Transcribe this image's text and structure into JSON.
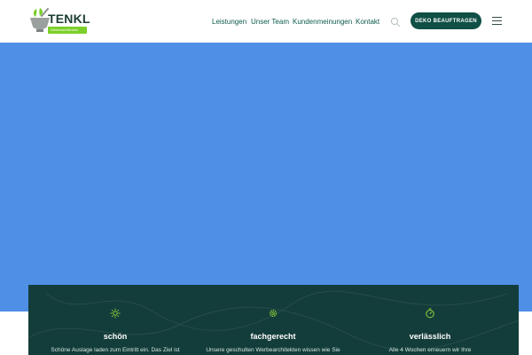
{
  "header": {
    "logo": {
      "word": "TENKL",
      "tagline": "Werbearchitekten"
    },
    "nav": [
      {
        "label": "Leistungen"
      },
      {
        "label": "Unser Team"
      },
      {
        "label": "Kundenmeinungen"
      },
      {
        "label": "Kontakt"
      }
    ],
    "search_icon": "search-icon",
    "cta_label": "DEKO BEAUFTRAGEN",
    "menu_icon": "hamburger-menu-icon"
  },
  "hero": {
    "background_color": "#4f8fe6"
  },
  "features": [
    {
      "icon": "sun-icon",
      "title": "schön",
      "text": "Schöne Auslage laden zum Eintritt ein. Das Ziel ist"
    },
    {
      "icon": "gear-icon",
      "title": "fachgerecht",
      "text": "Unsere geschulten Werbearchitekten wissen wie Sie"
    },
    {
      "icon": "stopwatch-icon",
      "title": "verlässlich",
      "text": "Alle 4 Wochen erneuern wir Ihre"
    }
  ],
  "colors": {
    "brand_dark": "#0f4f45",
    "accent_green": "#7ccf2a",
    "features_bg": "#133d3a",
    "nav_text": "#0d5b4e"
  }
}
